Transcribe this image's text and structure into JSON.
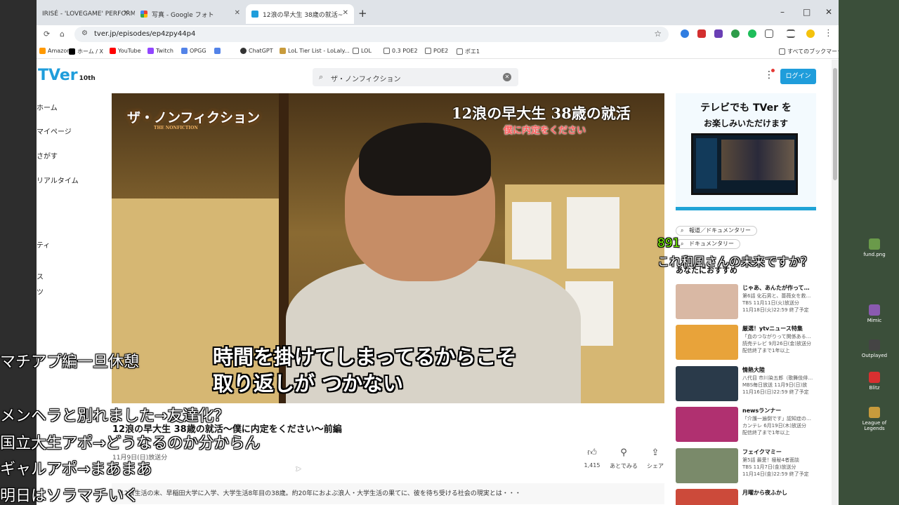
{
  "browser": {
    "tabs": [
      {
        "title": "IRISÉ - 'LOVEGAME' PERFORMA",
        "fav_color": "#d33"
      },
      {
        "title": "写真 - Google フォト",
        "fav_color": "#4285f4"
      },
      {
        "title": "12浪の早大生 38歳の就活~",
        "fav_color": "#1f9ddb"
      }
    ],
    "new_tab": "+",
    "url": "tver.jp/episodes/ep4zpy44p4",
    "window_controls": {
      "minimize": "–",
      "maximize": "□",
      "close": "✕"
    },
    "bookmarks": [
      {
        "label": "Amazon",
        "color": "#f90"
      },
      {
        "label": "ホーム / X",
        "color": "#000"
      },
      {
        "label": "YouTube",
        "color": "#f00"
      },
      {
        "label": "Twitch",
        "color": "#9146ff"
      },
      {
        "label": "OPGG",
        "color": "#5383e8"
      },
      {
        "label": "",
        "color": "#5383e8"
      },
      {
        "label": "ChatGPT",
        "color": "#333"
      },
      {
        "label": "LoL Tier List - LoLaly...",
        "color": "#c89b3c"
      },
      {
        "label": "LOL",
        "color": "#666"
      },
      {
        "label": "0.3 POE2",
        "color": "#666"
      },
      {
        "label": "POE2",
        "color": "#666"
      },
      {
        "label": "ポエ1",
        "color": "#666"
      }
    ],
    "all_bookmarks": "すべてのブックマーク"
  },
  "site": {
    "logo": "TVer",
    "logo_badge": "10th",
    "search_query": "ザ・ノンフィクション",
    "login": "ログイン",
    "sidebar": [
      "ホーム",
      "マイページ",
      "さがす",
      "リアルタイム",
      "ティ",
      "ス",
      "ツ"
    ]
  },
  "player": {
    "program_logo": "ザ・ノンフィクション",
    "program_logo_sub": "THE NONFICTION",
    "headline": "12浪の早大生 38歳の就活",
    "tagline": "僕に内定をください",
    "subtitle_line1": "時間を掛けてしまってるからこそ",
    "subtitle_line2": "取り返しが つかない"
  },
  "episode": {
    "title": "12浪の早大生 38歳の就活～僕に内定をください～前編",
    "date": "11月9日(日)放送分",
    "actions": [
      {
        "icon": "thumbs-up",
        "label": "1,415"
      },
      {
        "icon": "pin",
        "label": "あとでみる"
      },
      {
        "icon": "share",
        "label": "シェア"
      }
    ],
    "description": "12浪生活の末、早稲田大学に入学、大学生活8年目の38歳。約20年におよぶ浪人・大学生活の果てに、彼を待ち受ける社会の現実とは・・・"
  },
  "ad": {
    "line1": "テレビでも TVer を",
    "line2": "お楽しみいただけます"
  },
  "chips": [
    "報道／ドキュメンタリー",
    "ドキュメンタリー"
  ],
  "recommend_heading": "あなたにおすすめ",
  "recommendations": [
    {
      "title": "じゃあ、あんたが作って…",
      "meta1": "第6話 化石男と、薔薇女を救…",
      "meta2": "TBS 11月11日(火)放送分",
      "meta3": "11月18日(火)22:59 終了予定",
      "color": "#d9b8a4"
    },
    {
      "title": "厳選！ytvニュース特集",
      "meta1": "「血のつながりって関係ある…",
      "meta2": "読売テレビ 9月26日(金)放送分",
      "meta3": "配信終了まで1年以上",
      "color": "#e8a33a"
    },
    {
      "title": "情熱大陸",
      "meta1": "八代目 市川染五郎（歌舞伎俳…",
      "meta2": "MBS毎日放送 11月9日(日)放",
      "meta3": "11月16日(日)22:59 終了予定",
      "color": "#2a3a4a"
    },
    {
      "title": "newsランナー",
      "meta1": "「介護一遍倒です」認知症の…",
      "meta2": "カンテレ 6月19日(木)放送分",
      "meta3": "配信終了まで1年以上",
      "color": "#b03070"
    },
    {
      "title": "フェイクマミー",
      "meta1": "第5話 最愛！極秘4者面談",
      "meta2": "TBS 11月7日(金)放送分",
      "meta3": "11月14日(金)22:59 終了予定",
      "color": "#7a8a6a"
    },
    {
      "title": "月曜から夜ふかし",
      "meta1": "",
      "meta2": "",
      "meta3": "",
      "color": "#cc4a3a"
    }
  ],
  "danmaku": [
    {
      "text": "891",
      "color": "#7cfc00"
    },
    {
      "text": "これ和風さんの未来ですか？",
      "color": "#ffffff"
    },
    {
      "text": "マチアプ編一旦休憩",
      "color": "#ffffff"
    },
    {
      "text": "メンヘラと別れました→友達化？",
      "color": "#ffffff"
    },
    {
      "text": "国立大生アポ→どうなるのか分からん",
      "color": "#ffffff"
    },
    {
      "text": "ギャルアポ→まあまあ",
      "color": "#ffffff"
    },
    {
      "text": "明日はソラマチいく",
      "color": "#ffffff"
    }
  ],
  "desktop_icons": [
    {
      "label": "fund.png",
      "color": "#6a9a4a"
    },
    {
      "label": "Mimic",
      "color": "#8a5ab0"
    },
    {
      "label": "Outplayed",
      "color": "#444444"
    },
    {
      "label": "Blitz",
      "color": "#d83030"
    },
    {
      "label": "League of Legends",
      "color": "#c89b3c"
    }
  ]
}
